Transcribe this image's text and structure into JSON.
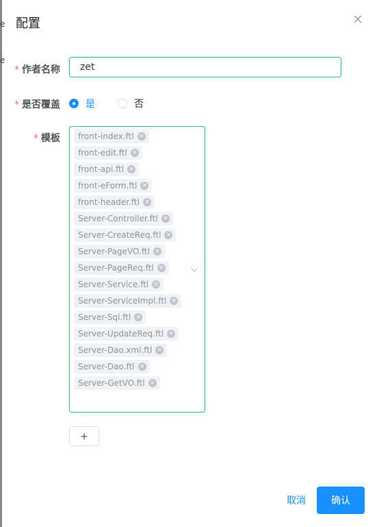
{
  "dialog": {
    "title": "配置"
  },
  "form": {
    "author": {
      "label": "作者名称",
      "value": "zet"
    },
    "overwrite": {
      "label": "是否覆盖",
      "options": [
        "是",
        "否"
      ],
      "selected": "是"
    },
    "templates": {
      "label": "模板",
      "selected": [
        "front-index.ftl",
        "front-edit.ftl",
        "front-api.ftl",
        "front-eForm.ftl",
        "front-header.ftl",
        "Server-Controller.ftl",
        "Server-CreateReq.ftl",
        "Server-PageVO.ftl",
        "Server-PageReq.ftl",
        "Server-Service.ftl",
        "Server-ServiceImpl.ftl",
        "Server-Sql.ftl",
        "Server-UpdateReq.ftl",
        "Server-Dao.xml.ftl",
        "Server-Dao.ftl",
        "Server-GetVO.ftl"
      ]
    },
    "required_mark": "*"
  },
  "add_button_label": "+",
  "footer": {
    "cancel_label": "取消",
    "confirm_label": "确认"
  },
  "colors": {
    "accent": "#1890ff",
    "focus_border": "#2fbf6c",
    "required": "#f56c6c"
  },
  "icons": {
    "close": "close-icon",
    "tag_close": "tag-close-icon",
    "dropdown": "chevron-down-icon"
  }
}
